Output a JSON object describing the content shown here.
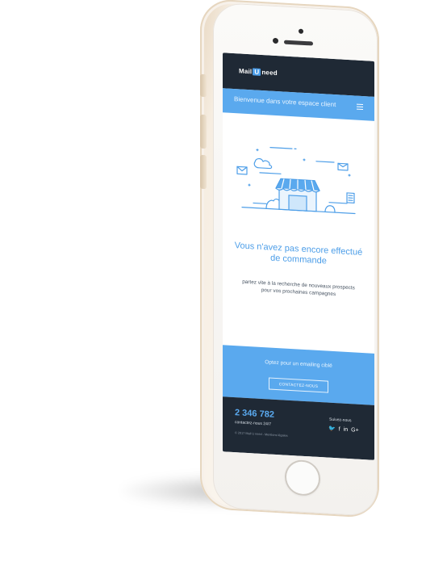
{
  "navbar": {
    "logo_part1": "Mail",
    "logo_part2": "U",
    "logo_part3": "need"
  },
  "hero": {
    "title": "Bienvenue dans votre espace client"
  },
  "empty_state": {
    "title": "Vous n'avez pas encore effectué de commande",
    "subtitle_line1": "partez vite à la recherche de nouveaux prospects",
    "subtitle_line2": "pour vos prochaines campagnes"
  },
  "cta": {
    "text": "Optez pour un emailing ciblé",
    "button_label": "CONTACTEZ-NOUS"
  },
  "footer": {
    "phone": "2 346 782",
    "contact_label": "contactez-nous 24/7",
    "copyright": "© 2017 Mail U need - Mentions légales",
    "follow_label": "Suivez-nous",
    "social": [
      "twitter",
      "facebook",
      "linkedin",
      "google-plus"
    ],
    "social_text": {
      "twitter": "🐦",
      "facebook": "f",
      "linkedin": "in",
      "googleplus": "G+"
    }
  },
  "colors": {
    "navy": "#1f2935",
    "accent_blue": "#5aa9ee",
    "phone_gold": "#f2e7d8",
    "text": "#4d5967"
  }
}
